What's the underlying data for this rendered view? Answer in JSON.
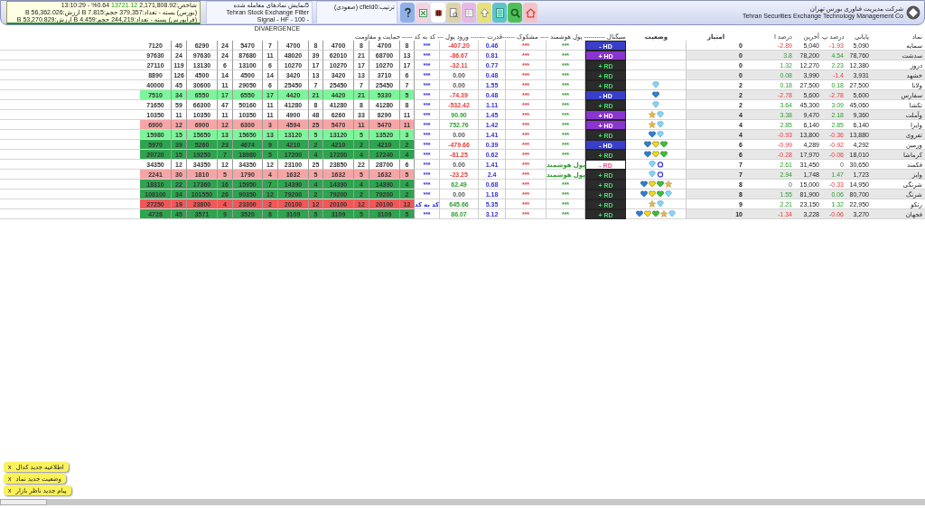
{
  "market_info": {
    "index_label": "شاخص:2,171,808.92",
    "index_change": "13721.12",
    "index_rest": "%0.64 - 13:10:29",
    "lines": [
      "(بورس) بسته - تعداد:379,357 حجم:7.815 B ارزش:56,362.026 B",
      "(فرابورس) بسته - تعداد:244,219 حجم:4.459 B ارزش:53,270.829 B"
    ]
  },
  "filter": {
    "lines": [
      "5نمایش نمادهای معامله شده",
      "Tehran Stock Exchange Filter",
      "Signal - HF - 100 -"
    ]
  },
  "sort": "ترتیب:cfield0 (صعودی)",
  "company": {
    "name_fa": "شرکت مدیریت فناوری بورس تهران",
    "name_en": "Tehran Securities Exchange Technology Management Co"
  },
  "block_title": "DIVAERGENCE",
  "columns": {
    "name": "نماد",
    "close": "پایانی",
    "pct_close": "درصد پ",
    "last": "آخرین",
    "pct_last": "درصد ا",
    "score": "امتیاز",
    "status": "وضعیت",
    "middle": "سیگنال ---------- پول هوشمند ---- مشکوک ------قدرت ------- ورود پول --- کد به کد ----- حمایت و مقاومت"
  },
  "rows": [
    {
      "name": "سمایه",
      "close": "5,090",
      "pct_close": {
        "text": "-1.93",
        "kind": "down"
      },
      "last": "5,040",
      "pct_last": {
        "text": "-2.89",
        "kind": "down"
      },
      "score": "0",
      "status": [],
      "signal": {
        "text": "- HD",
        "kind": "hd_minus"
      },
      "smart": "***",
      "suspicious": "***",
      "strength": "0.46",
      "flow": {
        "text": "-407.20",
        "kind": "down"
      },
      "code": "***",
      "color": "#ffffff",
      "nums": [
        "7120",
        "40",
        "6290",
        "24",
        "5470",
        "7",
        "4700",
        "8",
        "4700",
        "8",
        "4700",
        "8"
      ]
    },
    {
      "name": "سدشت",
      "close": "78,760",
      "pct_close": {
        "text": "4.54",
        "kind": "up"
      },
      "last": "78,200",
      "pct_last": {
        "text": "3.8",
        "kind": "up"
      },
      "score": "0",
      "status": [],
      "signal": {
        "text": "+ HD",
        "kind": "hd_plus"
      },
      "smart": "***",
      "suspicious": "***",
      "strength": "0.81",
      "flow": {
        "text": "-86.67",
        "kind": "down"
      },
      "code": "***",
      "color": "#ffffff",
      "nums": [
        "97630",
        "24",
        "97630",
        "24",
        "87680",
        "11",
        "48020",
        "39",
        "62010",
        "21",
        "68700",
        "13"
      ]
    },
    {
      "name": "دروز",
      "close": "12,380",
      "pct_close": {
        "text": "2.23",
        "kind": "up"
      },
      "last": "12,270",
      "pct_last": {
        "text": "1.32",
        "kind": "up"
      },
      "score": "0",
      "status": [],
      "signal": {
        "text": "+ RD",
        "kind": "rd_plus"
      },
      "smart": "***",
      "suspicious": "***",
      "strength": "0.77",
      "flow": {
        "text": "-32.11",
        "kind": "down"
      },
      "code": "***",
      "color": "#ffffff",
      "nums": [
        "27110",
        "119",
        "13130",
        "6",
        "13100",
        "6",
        "10270",
        "17",
        "10270",
        "17",
        "10270",
        "17"
      ]
    },
    {
      "name": "خشهد",
      "close": "3,931",
      "pct_close": {
        "text": "-1.4",
        "kind": "down"
      },
      "last": "3,990",
      "pct_last": {
        "text": "0.08",
        "kind": "up"
      },
      "score": "0",
      "status": [],
      "signal": {
        "text": "+ RD",
        "kind": "rd_plus"
      },
      "smart": "***",
      "suspicious": "***",
      "strength": "0.48",
      "flow": {
        "text": "0.00",
        "kind": "flat"
      },
      "code": "***",
      "color": "#ffffff",
      "nums": [
        "8890",
        "126",
        "4500",
        "14",
        "4500",
        "14",
        "3420",
        "13",
        "3420",
        "13",
        "3710",
        "6"
      ]
    },
    {
      "name": "ولانا",
      "close": "27,500",
      "pct_close": {
        "text": "0.18",
        "kind": "up"
      },
      "last": "27,500",
      "pct_last": {
        "text": "0.18",
        "kind": "up"
      },
      "score": "2",
      "status": [
        {
          "kind": "diamond"
        }
      ],
      "signal": {
        "text": "+ RD",
        "kind": "rd_plus"
      },
      "smart": "***",
      "suspicious": "***",
      "strength": "1.55",
      "flow": {
        "text": "0.00",
        "kind": "flat"
      },
      "code": "***",
      "color": "#ffffff",
      "nums": [
        "40000",
        "45",
        "30600",
        "11",
        "29050",
        "6",
        "25450",
        "7",
        "25450",
        "7",
        "25450",
        "7"
      ]
    },
    {
      "name": "سفارس",
      "close": "5,600",
      "pct_close": {
        "text": "-2.78",
        "kind": "down"
      },
      "last": "5,600",
      "pct_last": {
        "text": "-2.78",
        "kind": "down"
      },
      "score": "2",
      "status": [
        {
          "kind": "heart_blue"
        }
      ],
      "signal": {
        "text": "- HD",
        "kind": "hd_minus"
      },
      "smart": "***",
      "suspicious": "***",
      "strength": "0.48",
      "flow": {
        "text": "-74.39",
        "kind": "down"
      },
      "code": "***",
      "color": "#7df59a",
      "nums": [
        "7510",
        "34",
        "6550",
        "17",
        "6550",
        "17",
        "4420",
        "21",
        "4420",
        "21",
        "5330",
        "5"
      ]
    },
    {
      "name": "تکشا",
      "close": "45,060",
      "pct_close": {
        "text": "3.09",
        "kind": "up"
      },
      "last": "45,300",
      "pct_last": {
        "text": "3.64",
        "kind": "up"
      },
      "score": "2",
      "status": [
        {
          "kind": "diamond"
        }
      ],
      "signal": {
        "text": "+ RD",
        "kind": "rd_plus"
      },
      "smart": "***",
      "suspicious": "***",
      "strength": "1.11",
      "flow": {
        "text": "-532.42",
        "kind": "down"
      },
      "code": "***",
      "color": "#ffffff",
      "nums": [
        "71650",
        "59",
        "66300",
        "47",
        "50160",
        "11",
        "41280",
        "8",
        "41280",
        "8",
        "41280",
        "8"
      ]
    },
    {
      "name": "وآملت",
      "close": "9,360",
      "pct_close": {
        "text": "2.18",
        "kind": "up"
      },
      "last": "9,470",
      "pct_last": {
        "text": "3.38",
        "kind": "up"
      },
      "score": "4",
      "status": [
        {
          "kind": "star"
        },
        {
          "kind": "diamond"
        }
      ],
      "signal": {
        "text": "+ HD",
        "kind": "hd_plus"
      },
      "smart": "***",
      "suspicious": "***",
      "strength": "1.45",
      "flow": {
        "text": "90.90",
        "kind": "up"
      },
      "code": "***",
      "color": "#ffffff",
      "nums": [
        "10350",
        "11",
        "10350",
        "11",
        "10350",
        "11",
        "4900",
        "48",
        "6260",
        "33",
        "8290",
        "11"
      ]
    },
    {
      "name": "وایرا",
      "close": "6,140",
      "pct_close": {
        "text": "2.85",
        "kind": "up"
      },
      "last": "6,140",
      "pct_last": {
        "text": "2.85",
        "kind": "up"
      },
      "score": "4",
      "status": [
        {
          "kind": "star"
        },
        {
          "kind": "diamond"
        }
      ],
      "signal": {
        "text": "+ HD",
        "kind": "hd_plus"
      },
      "smart": "***",
      "suspicious": "***",
      "strength": "1.42",
      "flow": {
        "text": "752.76",
        "kind": "up"
      },
      "code": "***",
      "color": "#f6a5a5",
      "nums": [
        "6900",
        "12",
        "6900",
        "12",
        "6300",
        "3",
        "4594",
        "25",
        "5470",
        "11",
        "5470",
        "11"
      ]
    },
    {
      "name": "تفروی",
      "close": "13,880",
      "pct_close": {
        "text": "-0.36",
        "kind": "down"
      },
      "last": "13,800",
      "pct_last": {
        "text": "-0.93",
        "kind": "down"
      },
      "score": "4",
      "status": [
        {
          "kind": "heart_blue"
        },
        {
          "kind": "diamond"
        }
      ],
      "signal": {
        "text": "+ RD",
        "kind": "rd_plus"
      },
      "smart": "***",
      "suspicious": "***",
      "strength": "1.41",
      "flow": {
        "text": "0.00",
        "kind": "flat"
      },
      "code": "***",
      "color": "#7df59a",
      "nums": [
        "15980",
        "15",
        "15650",
        "13",
        "15650",
        "13",
        "13120",
        "5",
        "13120",
        "5",
        "13520",
        "3"
      ]
    },
    {
      "name": "ورمین",
      "close": "4,292",
      "pct_close": {
        "text": "-0.92",
        "kind": "down"
      },
      "last": "4,289",
      "pct_last": {
        "text": "-0.99",
        "kind": "down"
      },
      "score": "6",
      "status": [
        {
          "kind": "heart_blue"
        },
        {
          "kind": "heart_yellow"
        },
        {
          "kind": "heart_green"
        }
      ],
      "signal": {
        "text": "- HD",
        "kind": "hd_minus"
      },
      "smart": "***",
      "suspicious": "***",
      "strength": "0.39",
      "flow": {
        "text": "-479.66",
        "kind": "down"
      },
      "code": "***",
      "color": "#2ea44f",
      "nums": [
        "5970",
        "39",
        "5260",
        "23",
        "4674",
        "9",
        "4210",
        "2",
        "4210",
        "2",
        "4210",
        "2"
      ]
    },
    {
      "name": "کرماشا",
      "close": "18,010",
      "pct_close": {
        "text": "-0.06",
        "kind": "down"
      },
      "last": "17,970",
      "pct_last": {
        "text": "-0.28",
        "kind": "down"
      },
      "score": "6",
      "status": [
        {
          "kind": "heart_blue"
        },
        {
          "kind": "heart_yellow"
        },
        {
          "kind": "heart_green"
        }
      ],
      "signal": {
        "text": "+ RD",
        "kind": "rd_plus"
      },
      "smart": "***",
      "suspicious": "***",
      "strength": "0.62",
      "flow": {
        "text": "-81.25",
        "kind": "down"
      },
      "code": "***",
      "color": "#2ea44f",
      "nums": [
        "20720",
        "15",
        "19250",
        "7",
        "18980",
        "5",
        "17200",
        "4",
        "17200",
        "4",
        "17240",
        "4"
      ]
    },
    {
      "name": "فکمند",
      "close": "30,650",
      "pct_close": {
        "text": "0",
        "kind": "flat"
      },
      "last": "31,450",
      "pct_last": {
        "text": "2.61",
        "kind": "up"
      },
      "score": "7",
      "status": [
        {
          "kind": "diamond"
        },
        {
          "kind": "ring"
        }
      ],
      "signal": {
        "text": "- RD",
        "kind": "rd_minus"
      },
      "smart": "پول هوشمند",
      "suspicious": "***",
      "strength": "1.41",
      "flow": {
        "text": "0.00",
        "kind": "flat"
      },
      "code": "***",
      "color": "#ffffff",
      "nums": [
        "34350",
        "12",
        "34350",
        "12",
        "34350",
        "12",
        "23100",
        "25",
        "23850",
        "22",
        "28700",
        "6"
      ]
    },
    {
      "name": "وایز",
      "close": "1,723",
      "pct_close": {
        "text": "1.47",
        "kind": "up"
      },
      "last": "1,748",
      "pct_last": {
        "text": "2.94",
        "kind": "up"
      },
      "score": "7",
      "status": [
        {
          "kind": "diamond"
        },
        {
          "kind": "ring"
        }
      ],
      "signal": {
        "text": "+ RD",
        "kind": "rd_plus"
      },
      "smart": "پول هوشمند",
      "suspicious": "***",
      "strength": "2.4",
      "flow": {
        "text": "-23.25",
        "kind": "down"
      },
      "code": "***",
      "color": "#f6a5a5",
      "nums": [
        "2241",
        "30",
        "1810",
        "5",
        "1790",
        "4",
        "1632",
        "5",
        "1632",
        "5",
        "1632",
        "5"
      ]
    },
    {
      "name": "شرنگی",
      "close": "14,950",
      "pct_close": {
        "text": "-0.33",
        "kind": "down"
      },
      "last": "15,000",
      "pct_last": {
        "text": "0",
        "kind": "flat"
      },
      "score": "8",
      "status": [
        {
          "kind": "heart_blue"
        },
        {
          "kind": "heart_yellow"
        },
        {
          "kind": "heart_green"
        },
        {
          "kind": "star"
        }
      ],
      "signal": {
        "text": "+ RD",
        "kind": "rd_plus"
      },
      "smart": "***",
      "suspicious": "***",
      "strength": "0.68",
      "flow": {
        "text": "62.49",
        "kind": "up"
      },
      "code": "***",
      "color": "#2ea44f",
      "nums": [
        "18310",
        "22",
        "17360",
        "16",
        "15950",
        "7",
        "14390",
        "4",
        "14390",
        "4",
        "14390",
        "4"
      ]
    },
    {
      "name": "شرنگ",
      "close": "80,700",
      "pct_close": {
        "text": "0.06",
        "kind": "up"
      },
      "last": "81,900",
      "pct_last": {
        "text": "1.55",
        "kind": "up"
      },
      "score": "8",
      "status": [
        {
          "kind": "heart_blue"
        },
        {
          "kind": "heart_yellow"
        },
        {
          "kind": "heart_green"
        },
        {
          "kind": "diamond"
        }
      ],
      "signal": {
        "text": "+ RD",
        "kind": "rd_plus"
      },
      "smart": "***",
      "suspicious": "***",
      "strength": "1.18",
      "flow": {
        "text": "0.00",
        "kind": "flat"
      },
      "code": "***",
      "color": "#2ea44f",
      "nums": [
        "108100",
        "34",
        "101550",
        "26",
        "90350",
        "12",
        "79200",
        "2",
        "79200",
        "2",
        "79200",
        "2"
      ]
    },
    {
      "name": "رتکو",
      "close": "22,950",
      "pct_close": {
        "text": "1.32",
        "kind": "up"
      },
      "last": "23,150",
      "pct_last": {
        "text": "2.21",
        "kind": "up"
      },
      "score": "9",
      "status": [
        {
          "kind": "star"
        },
        {
          "kind": "diamond"
        }
      ],
      "signal": {
        "text": "+ RD",
        "kind": "rd_plus"
      },
      "smart": "***",
      "suspicious": "***",
      "strength": "5.35",
      "flow": {
        "text": "645.66",
        "kind": "up"
      },
      "code": "کد به کد",
      "color": "#f25757",
      "nums": [
        "27250",
        "19",
        "23800",
        "4",
        "23300",
        "2",
        "20100",
        "12",
        "20100",
        "12",
        "20100",
        "12"
      ]
    },
    {
      "name": "فجهان",
      "close": "3,270",
      "pct_close": {
        "text": "-0.06",
        "kind": "down"
      },
      "last": "3,228",
      "pct_last": {
        "text": "-1.34",
        "kind": "down"
      },
      "score": "10",
      "status": [
        {
          "kind": "heart_blue"
        },
        {
          "kind": "heart_yellow"
        },
        {
          "kind": "heart_green"
        },
        {
          "kind": "star"
        },
        {
          "kind": "diamond"
        }
      ],
      "signal": {
        "text": "+ RD",
        "kind": "rd_plus"
      },
      "smart": "***",
      "suspicious": "***",
      "strength": "3.12",
      "flow": {
        "text": "86.07",
        "kind": "up"
      },
      "code": "***",
      "color": "#2ea44f",
      "nums": [
        "4728",
        "45",
        "3571",
        "9",
        "3520",
        "8",
        "3109",
        "5",
        "3109",
        "5",
        "3109",
        "5"
      ]
    }
  ],
  "notices": [
    {
      "close": "x",
      "text": "اطلاعیه جدید کدال"
    },
    {
      "close": "x",
      "text": "وضعیت جدید نماد"
    },
    {
      "close": "x",
      "text": "پیام جدید ناظر بازار"
    }
  ]
}
